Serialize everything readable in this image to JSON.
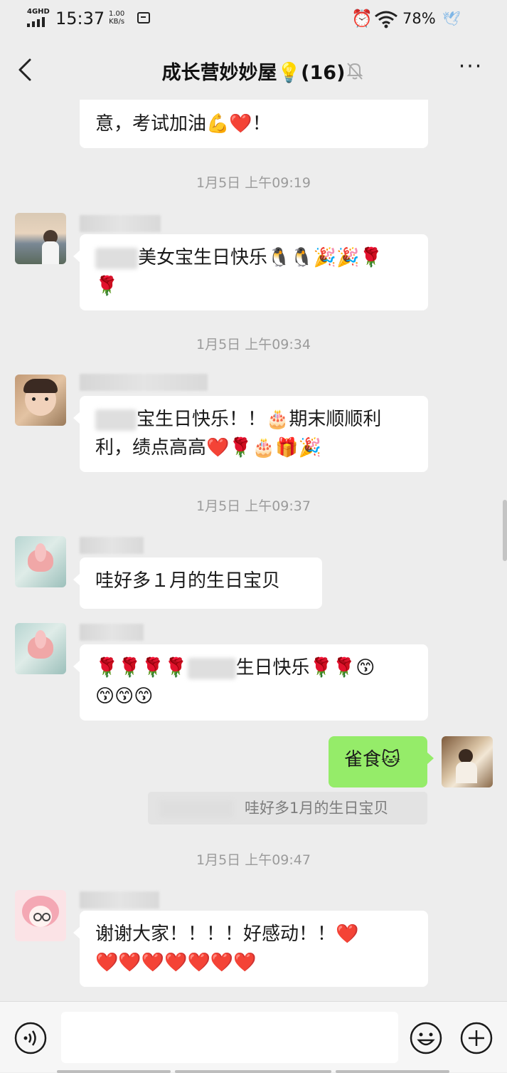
{
  "status_bar": {
    "network": "4GHD",
    "time": "15:37",
    "speed_value": "1.00",
    "speed_unit": "KB/s",
    "battery": "78%",
    "icons": [
      "signal-icon",
      "message-icon",
      "alarm-icon",
      "wifi-icon",
      "bird-icon"
    ]
  },
  "header": {
    "title": "成长营妙妙屋💡(16)",
    "back_icon": "chevron-left-icon",
    "mute_icon": "bell-off-icon",
    "more_label": "···"
  },
  "messages": {
    "m0_text": "意，考试加油💪❤️！",
    "t1": "1月5日 上午09:19",
    "m1_text_a": "美女宝生日快乐🐧🐧🎉🎉🌹",
    "m1_text_b": "🌹",
    "t2": "1月5日 上午09:34",
    "m2_text_a": "宝生日快乐！！🎂期末顺顺利",
    "m2_text_b": "利，绩点高高❤️🌹🎂🎁🎉",
    "t3": "1月5日 上午09:37",
    "m3_text": "哇好多１月的生日宝贝",
    "m4_text_a": "🌹🌹🌹🌹",
    "m4_text_b": "生日快乐🌹🌹😙",
    "m4_text_c": "😙😙😙",
    "me_text": "雀食🐱",
    "quote_text": "哇好多1月的生日宝贝",
    "t4": "1月5日 上午09:47",
    "m5_text_a": "谢谢大家！！！！好感动！！❤️",
    "m5_text_b": "❤️❤️❤️❤️❤️❤️❤️"
  },
  "input_bar": {
    "placeholder": "",
    "icons": [
      "voice-icon",
      "emoji-icon",
      "plus-icon"
    ]
  },
  "colors": {
    "background": "#ededed",
    "my_bubble": "#95ec69",
    "other_bubble": "#ffffff",
    "timestamp": "#9b9b9b"
  }
}
